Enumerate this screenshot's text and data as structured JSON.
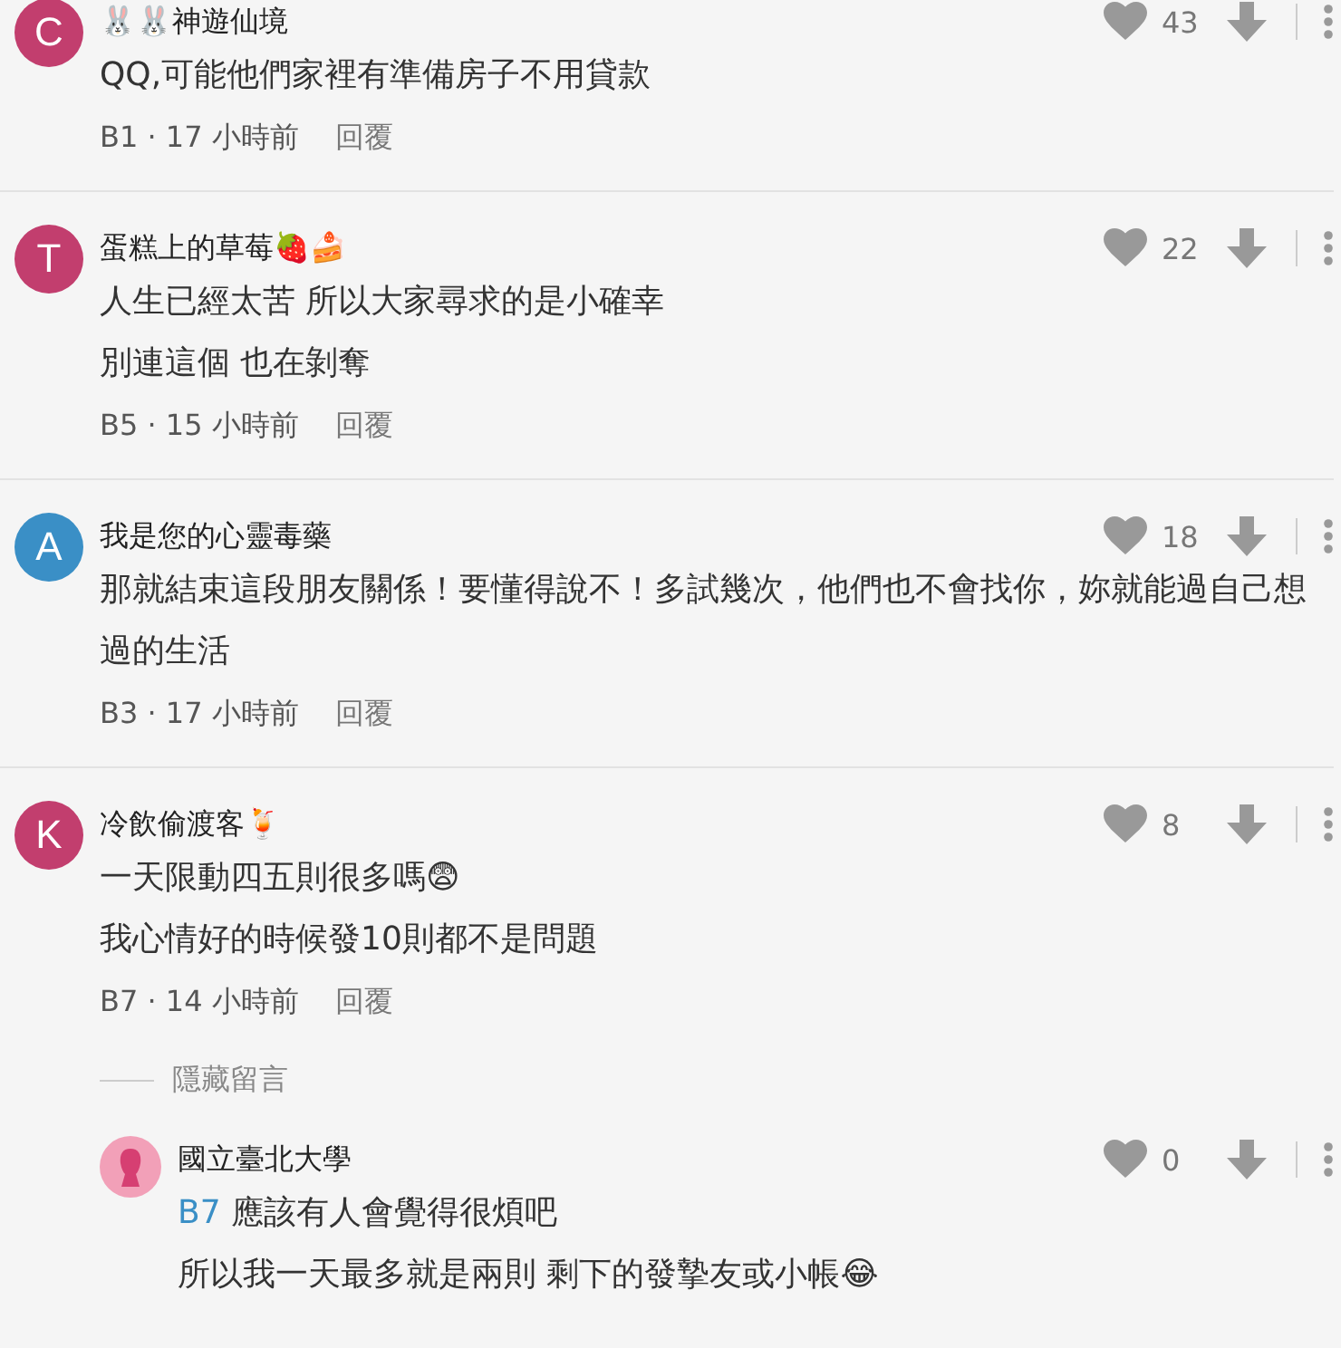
{
  "comments": [
    {
      "avatar": "C",
      "color": "#c23e6e",
      "name": "🐰🐰神遊仙境",
      "lines": [
        "QQ,可能他們家裡有準備房子不用貸款"
      ],
      "meta": "B1 · 17 小時前",
      "reply": "回覆",
      "likes": "43"
    },
    {
      "avatar": "T",
      "color": "#c23e6e",
      "name": "蛋糕上的草莓🍓🍰",
      "lines": [
        "人生已經太苦 所以大家尋求的是小確幸",
        "別連這個 也在剝奪"
      ],
      "meta": "B5 · 15 小時前",
      "reply": "回覆",
      "likes": "22"
    },
    {
      "avatar": "A",
      "color": "#3a8fc6",
      "name": "我是您的心靈毒藥",
      "lines": [
        "那就結束這段朋友關係！要懂得說不！多試幾次，他們也不會找你，妳就能過自己想過的生活"
      ],
      "meta": "B3 · 17 小時前",
      "reply": "回覆",
      "likes": "18"
    },
    {
      "avatar": "K",
      "color": "#c23e6e",
      "name": "冷飲偷渡客🍹",
      "lines": [
        "一天限動四五則很多嗎😨",
        "我心情好的時候發10則都不是問題"
      ],
      "meta": "B7 · 14 小時前",
      "reply": "回覆",
      "likes": "8",
      "hidden_label": "隱藏留言",
      "replies": [
        {
          "name": "國立臺北大學",
          "mention": "B7",
          "lines": [
            "應該有人會覺得很煩吧",
            "所以我一天最多就是兩則 剩下的發摯友或小帳😂"
          ],
          "likes": "0"
        }
      ]
    }
  ]
}
